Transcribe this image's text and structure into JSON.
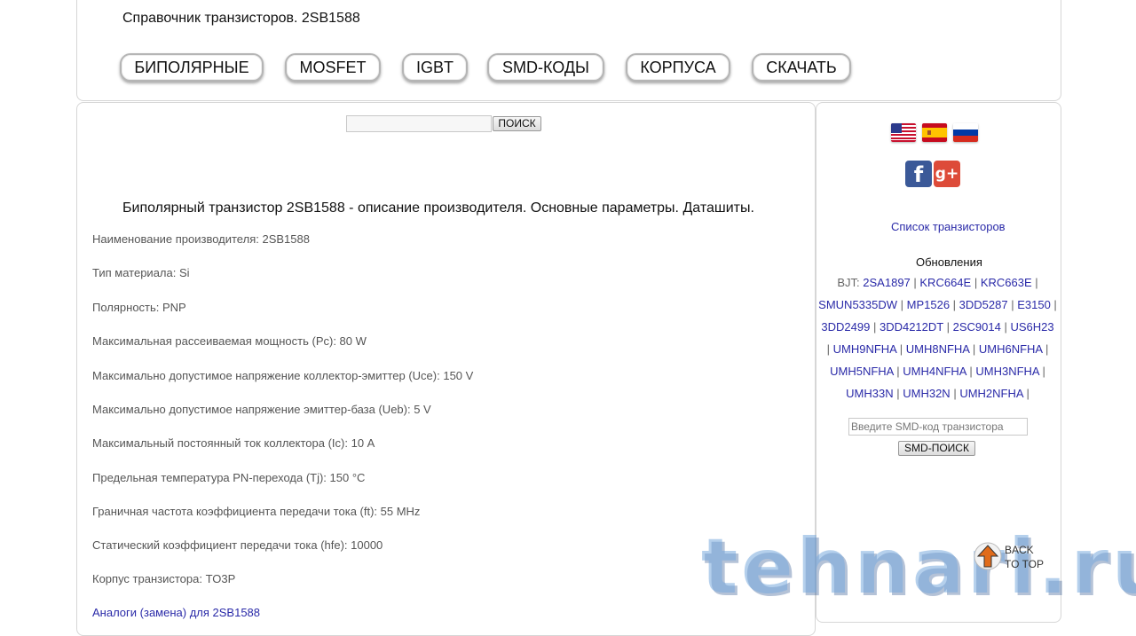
{
  "header": {
    "site_title": "Справочник транзисторов. 2SB1588",
    "nav": [
      {
        "label": "БИПОЛЯРНЫЕ"
      },
      {
        "label": "MOSFET"
      },
      {
        "label": "IGBT"
      },
      {
        "label": "SMD-КОДЫ"
      },
      {
        "label": "КОРПУСА"
      },
      {
        "label": "СКАЧАТЬ"
      }
    ]
  },
  "search": {
    "value": "",
    "button_label": "ПОИСК"
  },
  "main": {
    "heading": "Биполярный транзистор 2SB1588 - описание производителя. Основные параметры. Даташиты.",
    "params": [
      "Наименование производителя: 2SB1588",
      "Тип материала: Si",
      "Полярность: PNP",
      "Максимальная рассеиваемая мощность (Pc): 80 W",
      "Максимально допустимое напряжение коллектор-эмиттер (Uce): 150 V",
      "Максимально допустимое напряжение эмиттер-база (Ueb): 5 V",
      "Максимальный постоянный ток коллектора (Ic): 10 A",
      "Предельная температура PN-перехода (Tj): 150 °C",
      "Граничная частота коэффициента передачи тока (ft): 55 MHz",
      "Статический коэффициент передачи тока (hfe): 10000",
      "Корпус транзистора: TO3P"
    ],
    "analog_link": "Аналоги (замена) для 2SB1588"
  },
  "sidebar": {
    "flags": [
      "us-flag-icon",
      "spain-flag-icon",
      "russia-flag-icon"
    ],
    "social": {
      "facebook_label": "f",
      "gplus_label": "g+"
    },
    "transistor_list_link": "Список транзисторов",
    "updates_title": "Обновления",
    "updates_prefix": "BJT: ",
    "updates": [
      "2SA1897",
      "KRC664E",
      "KRC663E",
      "SMUN5335DW",
      "MP1526",
      "3DD5287",
      "E3150",
      "3DD2499",
      "3DD4212DT",
      "2SC9014",
      "US6H23",
      "UMH9NFHA",
      "UMH8NFHA",
      "UMH6NFHA",
      "UMH5NFHA",
      "UMH4NFHA",
      "UMH3NFHA",
      "UMH33N",
      "UMH32N",
      "UMH2NFHA"
    ],
    "smd_placeholder": "Введите SMD-код транзистора",
    "smd_button": "SMD-ПОИСК"
  },
  "watermark": "tehnari.ru",
  "back_to_top": {
    "line1": "BACK",
    "line2": "TO TOP"
  },
  "colors": {
    "link": "#2a2aa8",
    "text_gray": "#555555",
    "border": "#d6d6d6"
  }
}
